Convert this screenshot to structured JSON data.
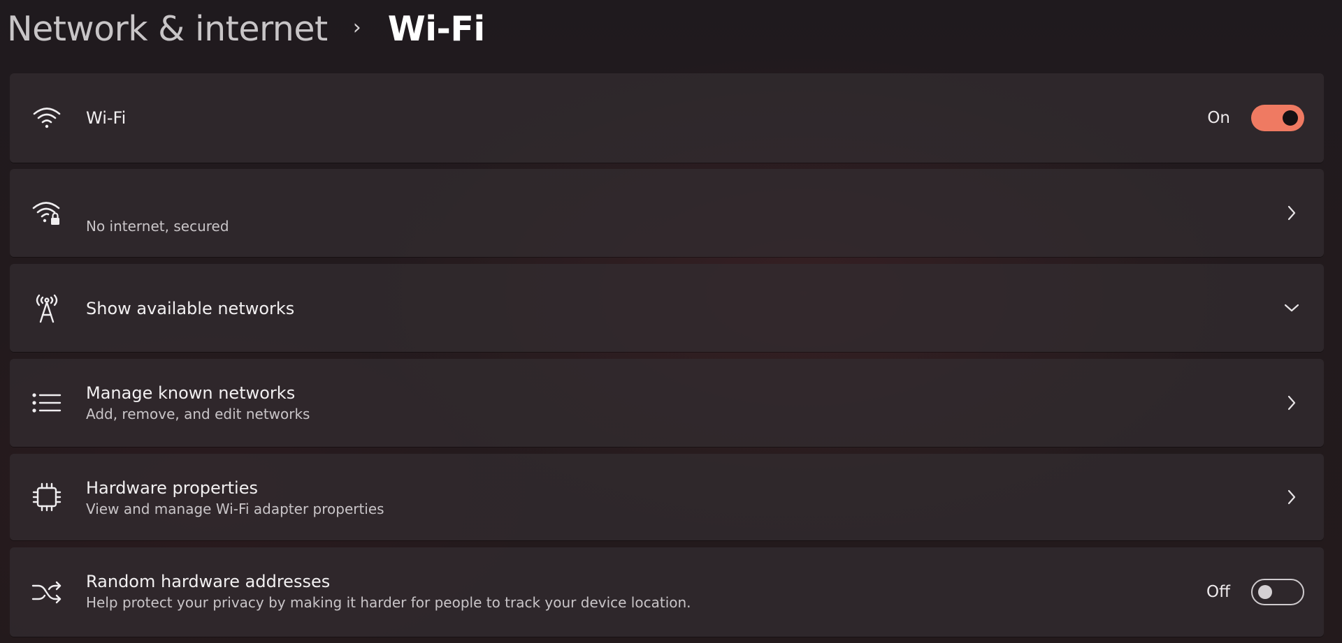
{
  "breadcrumb": {
    "parent": "Network & internet",
    "separator": "›",
    "current": "Wi-Fi"
  },
  "cards": {
    "wifi": {
      "title": "Wi-Fi",
      "icon": "wifi-icon",
      "toggle_label": "On",
      "toggle_state": "on"
    },
    "connection": {
      "subtitle": "No internet, secured",
      "icon": "wifi-lock-icon"
    },
    "available": {
      "title": "Show available networks",
      "icon": "antenna-icon"
    },
    "known": {
      "title": "Manage known networks",
      "subtitle": "Add, remove, and edit networks",
      "icon": "list-icon"
    },
    "hardware": {
      "title": "Hardware properties",
      "subtitle": "View and manage Wi-Fi adapter properties",
      "icon": "chip-icon"
    },
    "random": {
      "title": "Random hardware addresses",
      "subtitle": "Help protect your privacy by making it harder for people to track your device location.",
      "icon": "shuffle-icon",
      "toggle_label": "Off",
      "toggle_state": "off"
    }
  },
  "colors": {
    "accent": "#ef7a62",
    "card_bg": "#322c30",
    "text_primary": "#f2f0f1",
    "text_secondary": "#c9c5c8"
  }
}
